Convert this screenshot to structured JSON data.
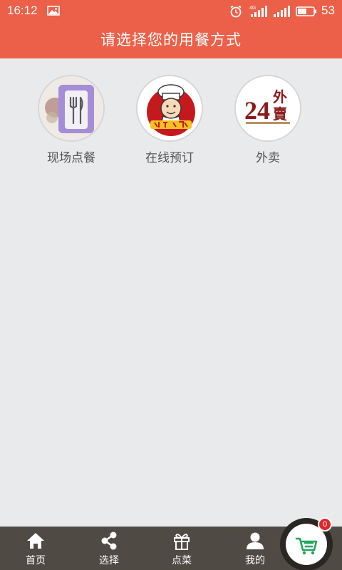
{
  "status_bar": {
    "time": "16:12",
    "network": "4G",
    "battery_level": "53",
    "icons": [
      "photo-icon",
      "alarm-icon",
      "signal-4g-icon",
      "signal-icon",
      "battery-icon"
    ]
  },
  "header": {
    "title": "请选择您的用餐方式"
  },
  "options": [
    {
      "label": "现场点餐",
      "icon": "cutlery-icon"
    },
    {
      "label": "在线预订",
      "icon": "chef-icon"
    },
    {
      "label": "外卖",
      "icon": "delivery-24-icon",
      "logo_number": "24",
      "logo_text_1": "外",
      "logo_text_2": "賣"
    }
  ],
  "bottom_nav": [
    {
      "label": "首页",
      "icon": "home-icon"
    },
    {
      "label": "选择",
      "icon": "share-icon"
    },
    {
      "label": "点菜",
      "icon": "gift-icon"
    },
    {
      "label": "我的",
      "icon": "user-icon"
    }
  ],
  "cart": {
    "count": "0",
    "icon": "cart-icon"
  },
  "colors": {
    "header": "#ec6049",
    "background": "#e9eaec",
    "nav": "#504a45",
    "badge": "#e0262a"
  }
}
